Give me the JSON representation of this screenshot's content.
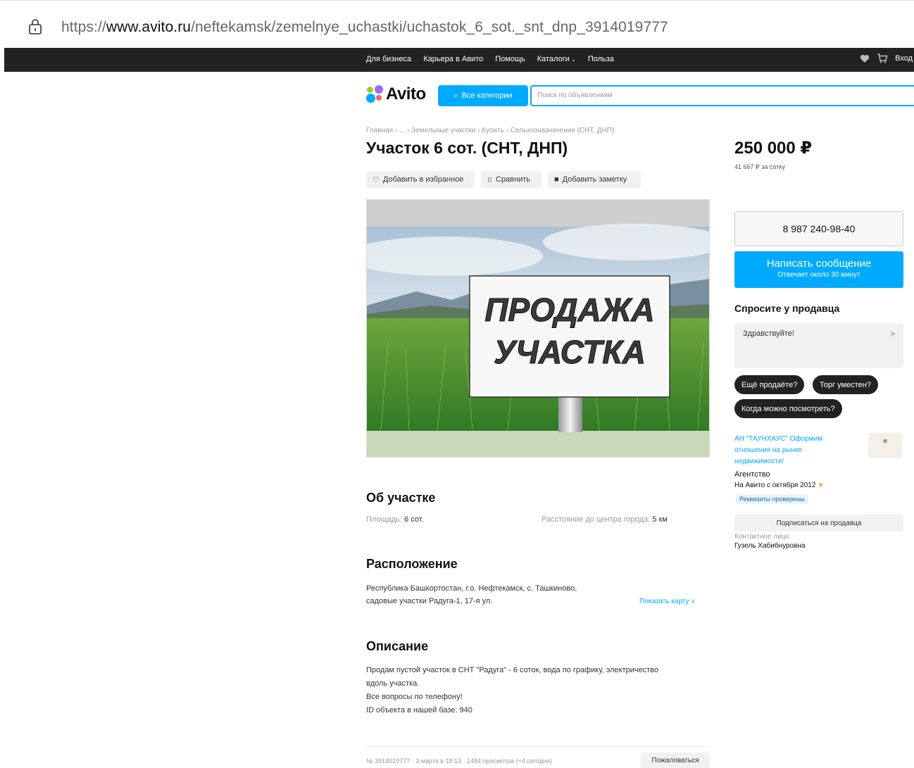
{
  "browser": {
    "url_scheme": "https://",
    "url_host": "www.avito.ru",
    "url_path": "/neftekamsk/zemelnye_uchastki/uchastok_6_sot._snt_dnp_3914019777"
  },
  "topnav": {
    "links": [
      "Для бизнеса",
      "Карьера в Авито",
      "Помощь",
      "Каталоги",
      "Польза"
    ],
    "login": "Вход"
  },
  "header": {
    "logo_text": "Avito",
    "categories_button": "Все категории",
    "search_placeholder": "Поиск по объявлениям"
  },
  "listing": {
    "breadcrumb": "Главная › ... › Земельные участки › Купить › Сельхозназначения (СНТ, ДНП)",
    "title": "Участок 6 сот. (СНТ, ДНП)",
    "actions": {
      "favorite": "Добавить в избранное",
      "compare": "Сравнить",
      "note": "Добавить заметку"
    },
    "photo_sign": {
      "line1": "ПРОДАЖА",
      "line2": "УЧАСТКА"
    },
    "about": {
      "heading": "Об участке",
      "area_label": "Площадь:",
      "area_value": "6 сот.",
      "distance_label": "Расстояние до центра города:",
      "distance_value": "5 км"
    },
    "location": {
      "heading": "Расположение",
      "line1": "Республика Башкортостан, г.о. Нефтекамск, с. Ташкиново,",
      "line2": "садовые участки Радуга-1, 17-я ул.",
      "show_map": "Показать карту"
    },
    "description": {
      "heading": "Описание",
      "line1": "Продам пустой участок в СНТ \"Радуга\" - 6 соток, вода по графику, электричество",
      "line2": "вдоль участка.",
      "line3": "Все вопросы по телефону!",
      "line4": "ID объекта в нашей базе: 940"
    },
    "footer_meta": "№ 3914019777 · 3 марта в 18:13 · 1484 просмотра (+4 сегодня)",
    "report": "Пожаловаться"
  },
  "sidebar": {
    "price": "250 000 ₽",
    "price_per": "41 667 ₽ за сотку",
    "phone": "8 987 240-98-40",
    "message_button": "Написать сообщение",
    "message_sub": "Отвечает около 30 минут",
    "ask_heading": "Спросите у продавца",
    "ask_placeholder": "Здравствуйте!",
    "chips": [
      "Ещё продаёте?",
      "Торг уместен?",
      "Когда можно посмотреть?"
    ],
    "seller_name": "АН \"ТАУНХАУС\" Оформим отношения на рынке недвижимости!",
    "seller_type": "Агентство",
    "seller_since": "На Авито с октября 2012",
    "verified": "Реквизиты проверены",
    "subscribe": "Подписаться на продавца",
    "contact_label": "Контактное лицо",
    "contact_name": "Гузель Хабибнуровна"
  },
  "colors": {
    "accent": "#00aaff",
    "topbar": "#222222",
    "chip": "#222222"
  }
}
